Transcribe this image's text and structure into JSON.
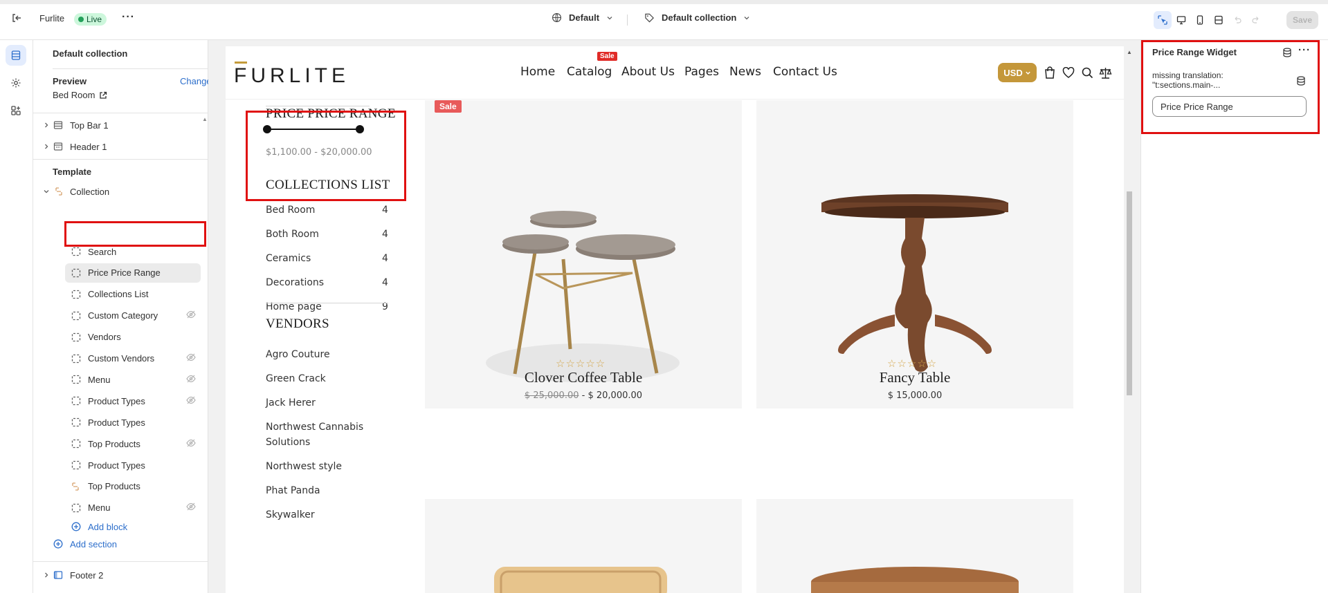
{
  "topbar": {
    "store_name": "Furlite",
    "status_badge": "Live",
    "theme_selector": "Default",
    "template_selector": "Default collection",
    "save_label": "Save"
  },
  "sidebar": {
    "section_title": "Default collection",
    "preview_label": "Preview",
    "change_link": "Change",
    "preview_value": "Bed Room",
    "header_items": [
      {
        "label": "Top Bar 1"
      },
      {
        "label": "Header 1"
      }
    ],
    "template_label": "Template",
    "collection_label": "Collection",
    "blocks": [
      {
        "label": "Search",
        "hidden": false
      },
      {
        "label": "Price Price Range",
        "hidden": false
      },
      {
        "label": "Collections List",
        "hidden": false
      },
      {
        "label": "Custom Category",
        "hidden": true
      },
      {
        "label": "Vendors",
        "hidden": false
      },
      {
        "label": "Custom Vendors",
        "hidden": true
      },
      {
        "label": "Menu",
        "hidden": true
      },
      {
        "label": "Product Types",
        "hidden": true
      },
      {
        "label": "Product Types",
        "hidden": false
      },
      {
        "label": "Top Products",
        "hidden": true
      },
      {
        "label": "Product Types",
        "hidden": false
      },
      {
        "label": "Top Products",
        "hidden": false
      },
      {
        "label": "Menu",
        "hidden": true
      }
    ],
    "add_block": "Add block",
    "add_section": "Add section",
    "footer_item": "Footer 2"
  },
  "storefront": {
    "logo": "FURLITE",
    "nav": [
      "Home",
      "Catalog",
      "About Us",
      "Pages",
      "News",
      "Contact Us"
    ],
    "nav_sale_tag": "Sale",
    "currency": "USD",
    "price_range": {
      "title": "PRICE PRICE RANGE",
      "range_text": "$1,100.00 - $20,000.00",
      "min_fraction": 0.0,
      "max_fraction": 1.0
    },
    "collections_list": {
      "title": "COLLECTIONS LIST",
      "items": [
        {
          "name": "Bed Room",
          "count": "4"
        },
        {
          "name": "Both Room",
          "count": "4"
        },
        {
          "name": "Ceramics",
          "count": "4"
        },
        {
          "name": "Decorations",
          "count": "4"
        },
        {
          "name": "Home page",
          "count": "9"
        }
      ]
    },
    "vendors": {
      "title": "VENDORS",
      "items": [
        "Agro Couture",
        "Green Crack",
        "Jack Herer",
        "Northwest Cannabis",
        "Solutions",
        "Northwest style",
        "Phat Panda",
        "Skywalker"
      ]
    },
    "products": [
      {
        "badge": "Sale",
        "stars": "☆☆☆☆☆",
        "title": "Clover Coffee Table",
        "old_price": "$ 25,000.00",
        "price_sep": "-",
        "price": "$ 20,000.00"
      },
      {
        "badge": "",
        "stars": "☆☆☆☆☆",
        "title": "Fancy Table",
        "old_price": "",
        "price_sep": "",
        "price": "$ 15,000.00"
      }
    ]
  },
  "settings_panel": {
    "title": "Price Range Widget",
    "field_label_line1": "missing translation:",
    "field_label_line2": "\"t:sections.main-...",
    "field_value": "Price Price Range"
  },
  "colors": {
    "accent_blue": "#2c6ecb",
    "highlight_red": "#e01010",
    "brand_gold": "#c4973a",
    "sale_red": "#e02b27"
  }
}
